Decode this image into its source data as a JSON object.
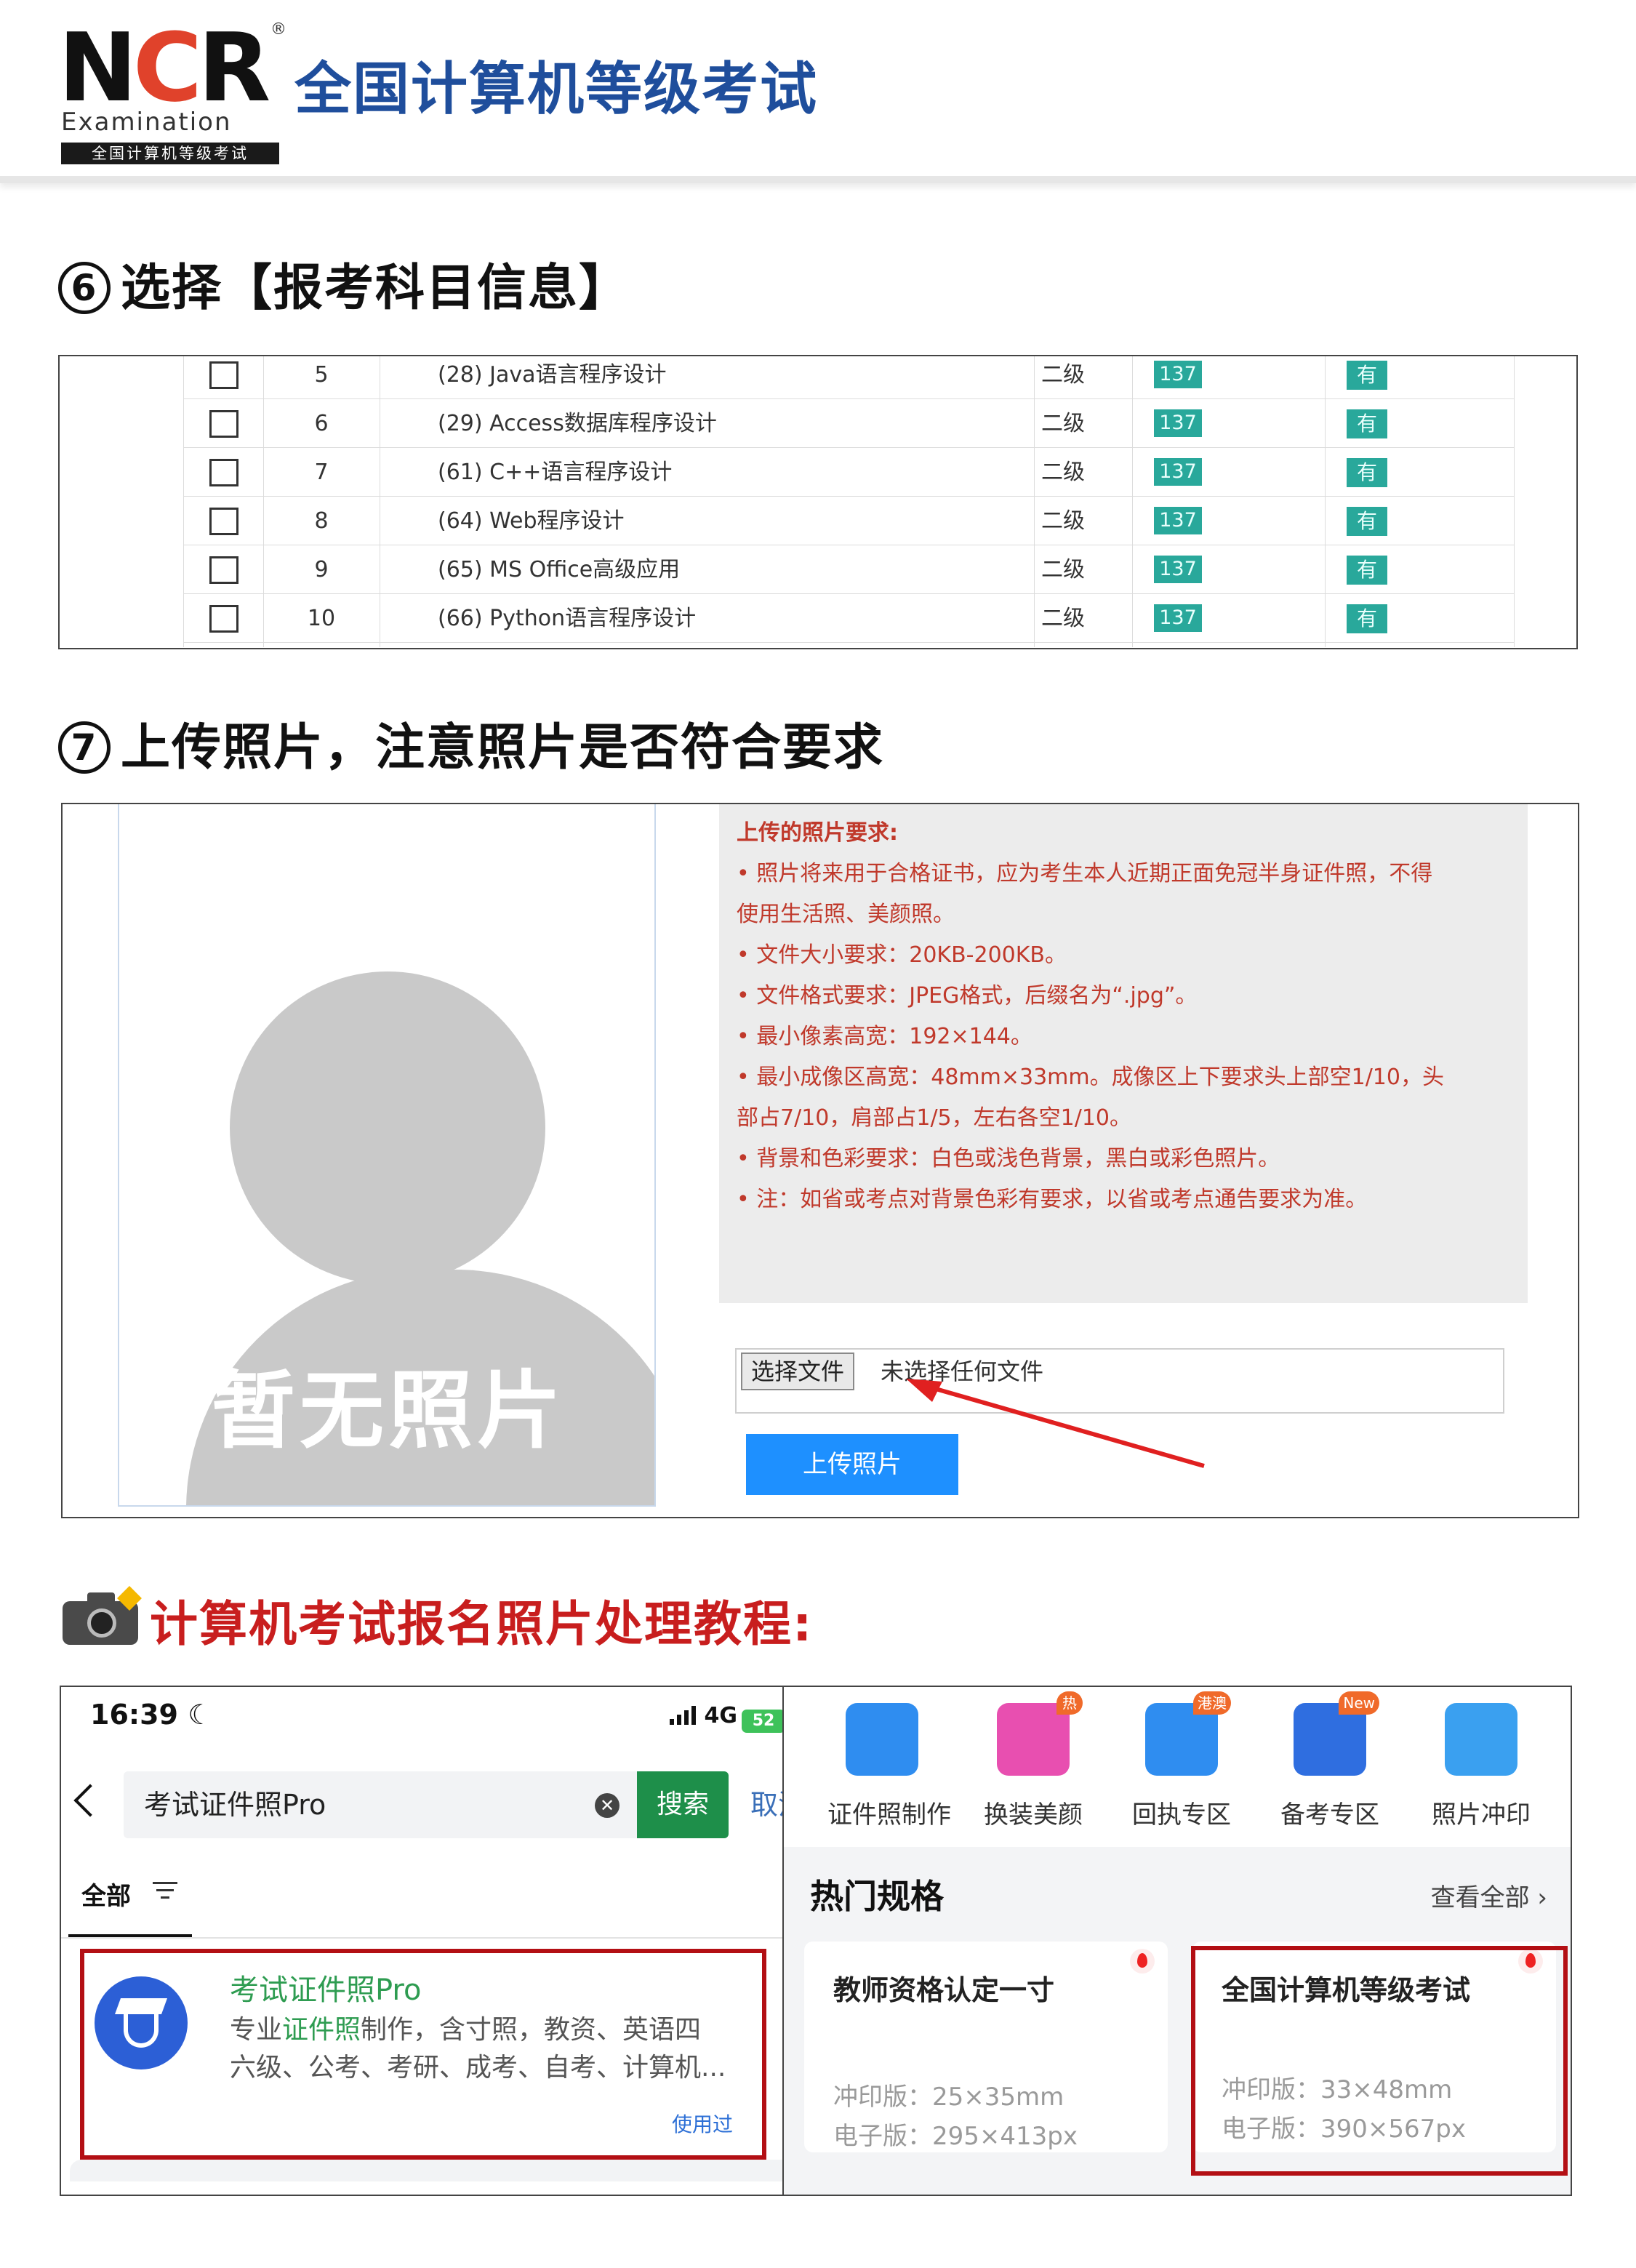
{
  "header": {
    "logo_letters": "NCR",
    "logo_en": "Examination",
    "logo_sub": "全国计算机等级考试",
    "title": "全国计算机等级考试"
  },
  "step6": {
    "number": "⑥",
    "title": "选择【报考科目信息】",
    "rows": [
      {
        "no": "5",
        "name": "(28) Java语言程序设计",
        "level": "二级",
        "fee": "137",
        "status": "有"
      },
      {
        "no": "6",
        "name": "(29) Access数据库程序设计",
        "level": "二级",
        "fee": "137",
        "status": "有"
      },
      {
        "no": "7",
        "name": "(61) C++语言程序设计",
        "level": "二级",
        "fee": "137",
        "status": "有"
      },
      {
        "no": "8",
        "name": "(64) Web程序设计",
        "level": "二级",
        "fee": "137",
        "status": "有"
      },
      {
        "no": "9",
        "name": "(65) MS Office高级应用",
        "level": "二级",
        "fee": "137",
        "status": "有"
      },
      {
        "no": "10",
        "name": "(66) Python语言程序设计",
        "level": "二级",
        "fee": "137",
        "status": "有"
      }
    ]
  },
  "step7": {
    "number": "⑦",
    "title": "上传照片，注意照片是否符合要求",
    "photo_placeholder": "暂无照片",
    "requirements_title": "上传的照片要求:",
    "requirements": [
      "• 照片将来用于合格证书，应为考生本人近期正面免冠半身证件照，不得",
      "使用生活照、美颜照。",
      "• 文件大小要求：20KB-200KB。",
      "• 文件格式要求：JPEG格式，后缀名为“.jpg”。",
      "• 最小像素高宽：192×144。",
      "• 最小成像区高宽：48mm×33mm。成像区上下要求头上部空1/10，头",
      "部占7/10，肩部占1/5，左右各空1/10。",
      "• 背景和色彩要求：白色或浅色背景，黑白或彩色照片。",
      "• 注：如省或考点对背景色彩有要求，以省或考点通告要求为准。"
    ],
    "choose_file": "选择文件",
    "no_file": "未选择任何文件",
    "upload_button": "上传照片"
  },
  "tutorial": {
    "title": "计算机考试报名照片处理教程:"
  },
  "left_phone": {
    "time": "16:39",
    "network": "4G",
    "battery": "52",
    "search_value": "考试证件照Pro",
    "search_button": "搜索",
    "cancel": "取消",
    "tab_all": "全部",
    "result": {
      "title": "考试证件照Pro",
      "desc_line1_pre": "专业",
      "desc_line1_hl": "证件照",
      "desc_line1_post": "制作，含寸照，教资、英语四",
      "desc_line2": "六级、公考、考研、成考、自考、计算机...",
      "use_link": "使用过"
    }
  },
  "right_phone": {
    "categories": [
      {
        "label": "证件照制作",
        "badge": "",
        "color": "#2f8df0"
      },
      {
        "label": "换装美颜",
        "badge": "热",
        "color": "#e84fb0"
      },
      {
        "label": "回执专区",
        "badge": "港澳",
        "color": "#2f8df0"
      },
      {
        "label": "备考专区",
        "badge": "New",
        "color": "#2f6ee0"
      },
      {
        "label": "照片冲印",
        "badge": "",
        "color": "#3aa0f0"
      }
    ],
    "hot_title": "热门规格",
    "view_all": "查看全部 ›",
    "specs": [
      {
        "title": "教师资格认定一寸",
        "print": "冲印版：25×35mm",
        "digital": "电子版：295×413px"
      },
      {
        "title": "全国计算机等级考试",
        "print": "冲印版：33×48mm",
        "digital": "电子版：390×567px"
      }
    ]
  }
}
